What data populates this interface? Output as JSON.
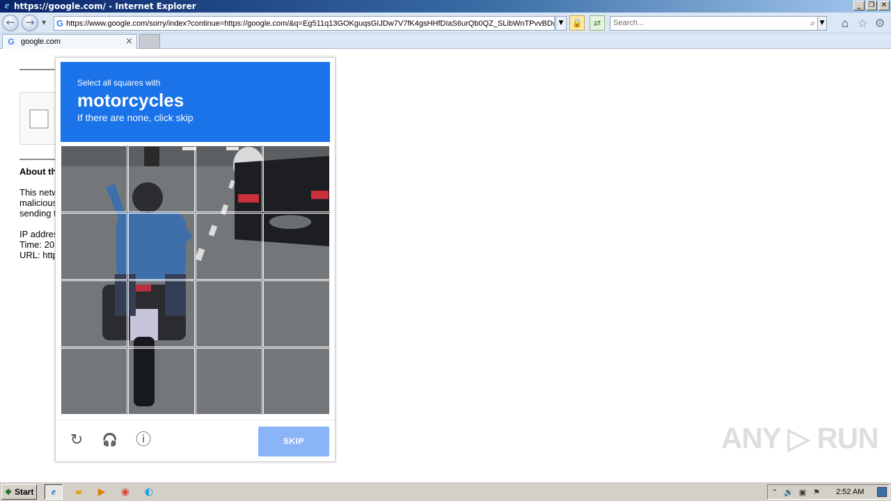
{
  "window": {
    "title": "https://google.com/ - Internet Explorer",
    "min_label": "_",
    "max_label": "❐",
    "close_label": "✕"
  },
  "toolbar": {
    "back_icon": "←",
    "forward_icon": "→",
    "address_url": "https://www.google.com/sorry/index?continue=https://google.com/&q=Eg511q13GOKguqsGIJDw7V7fK4gsHHfDIaS6urQb0QZ_SLibWnTPvvBDwE",
    "search_placeholder": "Search...",
    "home_icon": "⌂",
    "favorites_icon": "☆",
    "tools_icon": "⚙"
  },
  "tab": {
    "title": "google.com",
    "close": "×"
  },
  "page": {
    "about_heading": "About th",
    "body_lines": [
      "This netw",
      "malicious",
      "sending t"
    ],
    "ip_line": "IP addres",
    "time_line": "Time: 20",
    "url_line": "URL: http"
  },
  "captcha": {
    "instruction_line1": "Select all squares with",
    "target_object": "motorcycles",
    "instruction_line3": "If there are none, click skip",
    "grid_rows": 4,
    "grid_cols": 4,
    "reload_icon": "↻",
    "audio_icon": "🎧",
    "info_icon": "ⓘ",
    "skip_label": "SKIP",
    "accent_color": "#1a73e8",
    "skip_color": "#8ab4f8"
  },
  "watermark": "ANY ▷ RUN",
  "taskbar": {
    "start_label": "Start",
    "clock": "2:52 AM"
  }
}
